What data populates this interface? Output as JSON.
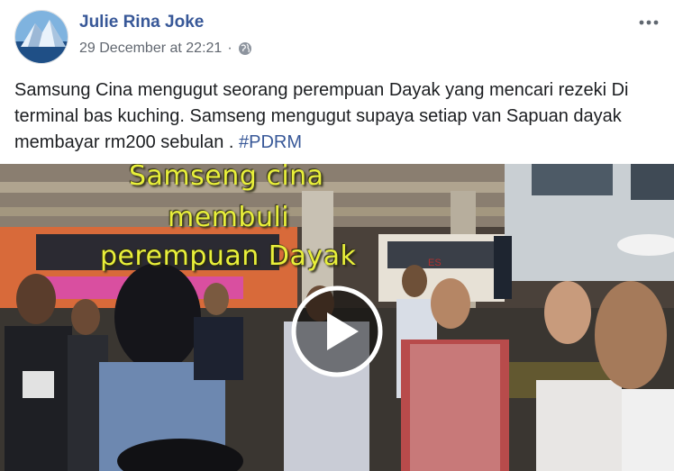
{
  "post": {
    "author": "Julie Rina Joke",
    "timestamp": "29 December at 22:21",
    "separator": "·",
    "text_main": "Samsung Cina mengugut seorang perempuan Dayak yang mencari rezeki Di terminal bas kuching. Samseng mengugut supaya setiap van Sapuan dayak membayar rm200 sebulan . ",
    "hashtag": "#PDRM"
  },
  "video": {
    "caption_lines": [
      "Samseng cina",
      "membuli",
      "perempuan Dayak"
    ],
    "bus_sign": "ES"
  },
  "icons": {
    "privacy": "globe-icon",
    "menu": "more-options-icon",
    "play": "play-icon"
  },
  "colors": {
    "author_link": "#385898",
    "meta": "#616770",
    "caption": "#e8ef3a"
  }
}
